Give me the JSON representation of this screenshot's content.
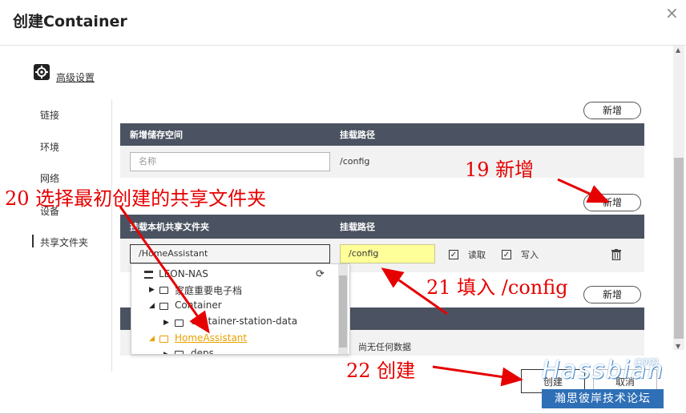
{
  "dialog": {
    "title": "创建Container",
    "close_icon": "×"
  },
  "advanced": {
    "label": "高级设置"
  },
  "sidebar": {
    "items": [
      {
        "label": "链接"
      },
      {
        "label": "环境"
      },
      {
        "label": "网络"
      },
      {
        "label": "设备"
      },
      {
        "label": "共享文件夹"
      }
    ],
    "active": "共享文件夹"
  },
  "volumes": {
    "add_label": "新增",
    "header_name": "新增储存空间",
    "header_path": "挂载路径",
    "name_placeholder": "名称",
    "path_value": "/config"
  },
  "shares": {
    "add_label": "新增",
    "header_name": "挂载本机共享文件夹",
    "header_path": "挂载路径",
    "folder_value": "/HomeAssistant",
    "path_value": "/config",
    "read_label": "读取",
    "write_label": "写入",
    "tree": {
      "root": "LEON-NAS",
      "items": [
        {
          "label": "家庭重要电子档",
          "level": 1
        },
        {
          "label": "Container",
          "level": 1
        },
        {
          "label": "container-station-data",
          "level": 2
        },
        {
          "label": "HomeAssistant",
          "level": 1
        },
        {
          "label": "deps",
          "level": 2
        }
      ]
    }
  },
  "third_add_label": "新增",
  "empty_text": "尚无任何数据",
  "footer": {
    "create_label": "创建",
    "cancel_label": "取消"
  },
  "annotations": {
    "a19": "19 新增",
    "a20": "20 选择最初创建的共享文件夹",
    "a21": "21 填入 /config",
    "a22": "22 创建"
  },
  "watermark": {
    "brand": "Hassbian",
    "com": "com",
    "sub": "瀚思彼岸技术论坛"
  },
  "colors": {
    "header_bg": "#4b5362",
    "annotation": "#e60000",
    "highlight_input": "#ffff99",
    "selected_folder": "#e8a000"
  }
}
